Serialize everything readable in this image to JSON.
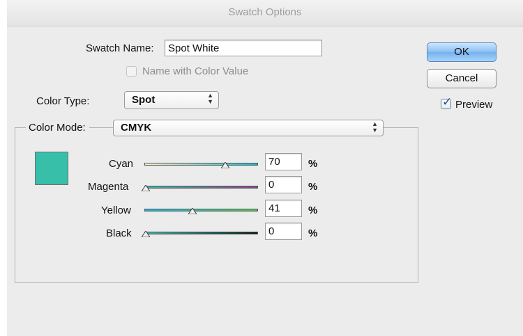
{
  "window": {
    "title": "Swatch Options"
  },
  "swatch_name": {
    "label": "Swatch Name:",
    "value": "Spot White"
  },
  "name_with_color_value": {
    "label": "Name with Color Value",
    "checked": false,
    "enabled": false
  },
  "color_type": {
    "label": "Color Type:",
    "selected": "Spot"
  },
  "color_mode": {
    "label": "Color Mode:",
    "selected": "CMYK"
  },
  "preview_swatch_color": "#38bfaa",
  "sliders": [
    {
      "name": "Cyan",
      "value": "70",
      "unit": "%",
      "position_percent": 70
    },
    {
      "name": "Magenta",
      "value": "0",
      "unit": "%",
      "position_percent": 0
    },
    {
      "name": "Yellow",
      "value": "41",
      "unit": "%",
      "position_percent": 41
    },
    {
      "name": "Black",
      "value": "0",
      "unit": "%",
      "position_percent": 0
    }
  ],
  "buttons": {
    "ok": "OK",
    "cancel": "Cancel"
  },
  "preview": {
    "label": "Preview",
    "checked": true
  },
  "colors": {
    "accent_blue": "#76b1ee",
    "swatch": "#38bfaa"
  }
}
